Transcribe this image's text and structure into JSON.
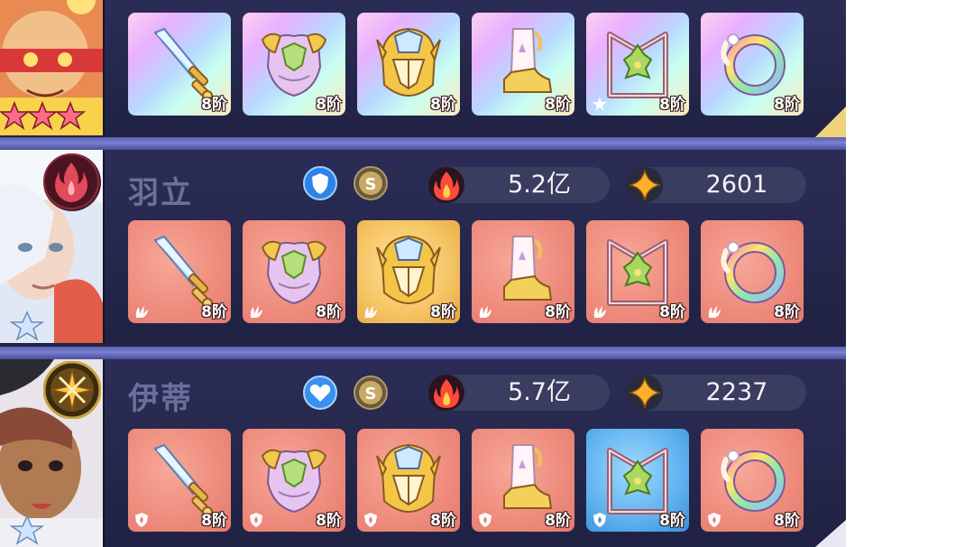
{
  "rows": [
    {
      "id": "row-top",
      "name": "",
      "equipment": [
        {
          "slot": "weapon",
          "tier_label": "8阶",
          "bg": "holo",
          "mark": "none"
        },
        {
          "slot": "armor",
          "tier_label": "8阶",
          "bg": "holo",
          "mark": "none"
        },
        {
          "slot": "helmet",
          "tier_label": "8阶",
          "bg": "holo",
          "mark": "none"
        },
        {
          "slot": "boots",
          "tier_label": "8阶",
          "bg": "holo",
          "mark": "none"
        },
        {
          "slot": "emblem",
          "tier_label": "8阶",
          "bg": "holo",
          "mark": "star"
        },
        {
          "slot": "ring",
          "tier_label": "8阶",
          "bg": "holo",
          "mark": "none"
        }
      ],
      "star_count": 3
    },
    {
      "id": "row-yuli",
      "name": "羽立",
      "class_icon": "flame-icon",
      "faction_icon": "shield-icon",
      "rank_icon": "s-rank-icon",
      "rank_letter": "S",
      "power": "5.2亿",
      "power_icon": "fire-icon",
      "level": "2601",
      "level_icon": "sparkle-icon",
      "equipment": [
        {
          "slot": "weapon",
          "tier_label": "8阶",
          "bg": "salmon",
          "mark": "leaf"
        },
        {
          "slot": "armor",
          "tier_label": "8阶",
          "bg": "salmon",
          "mark": "leaf"
        },
        {
          "slot": "helmet",
          "tier_label": "8阶",
          "bg": "gold",
          "mark": "leaf"
        },
        {
          "slot": "boots",
          "tier_label": "8阶",
          "bg": "salmon",
          "mark": "leaf"
        },
        {
          "slot": "emblem",
          "tier_label": "8阶",
          "bg": "salmon",
          "mark": "leaf"
        },
        {
          "slot": "ring",
          "tier_label": "8阶",
          "bg": "salmon",
          "mark": "leaf"
        }
      ]
    },
    {
      "id": "row-yidi",
      "name": "伊蒂",
      "class_icon": "crossed-swords-icon",
      "faction_icon": "heart-icon",
      "rank_icon": "s-rank-icon",
      "rank_letter": "S",
      "power": "5.7亿",
      "power_icon": "fire-icon",
      "level": "2237",
      "level_icon": "sparkle-icon",
      "equipment": [
        {
          "slot": "weapon",
          "tier_label": "8阶",
          "bg": "salmon",
          "mark": "shield"
        },
        {
          "slot": "armor",
          "tier_label": "8阶",
          "bg": "salmon",
          "mark": "shield"
        },
        {
          "slot": "helmet",
          "tier_label": "8阶",
          "bg": "salmon",
          "mark": "shield"
        },
        {
          "slot": "boots",
          "tier_label": "8阶",
          "bg": "salmon",
          "mark": "shield"
        },
        {
          "slot": "emblem",
          "tier_label": "8阶",
          "bg": "blue",
          "mark": "shield"
        },
        {
          "slot": "ring",
          "tier_label": "8阶",
          "bg": "salmon",
          "mark": "shield"
        }
      ]
    }
  ],
  "colors": {
    "panel": "#232546",
    "separator": "#6a6fc0",
    "pill": "#3a3c60",
    "name": "#6c6f9a"
  }
}
